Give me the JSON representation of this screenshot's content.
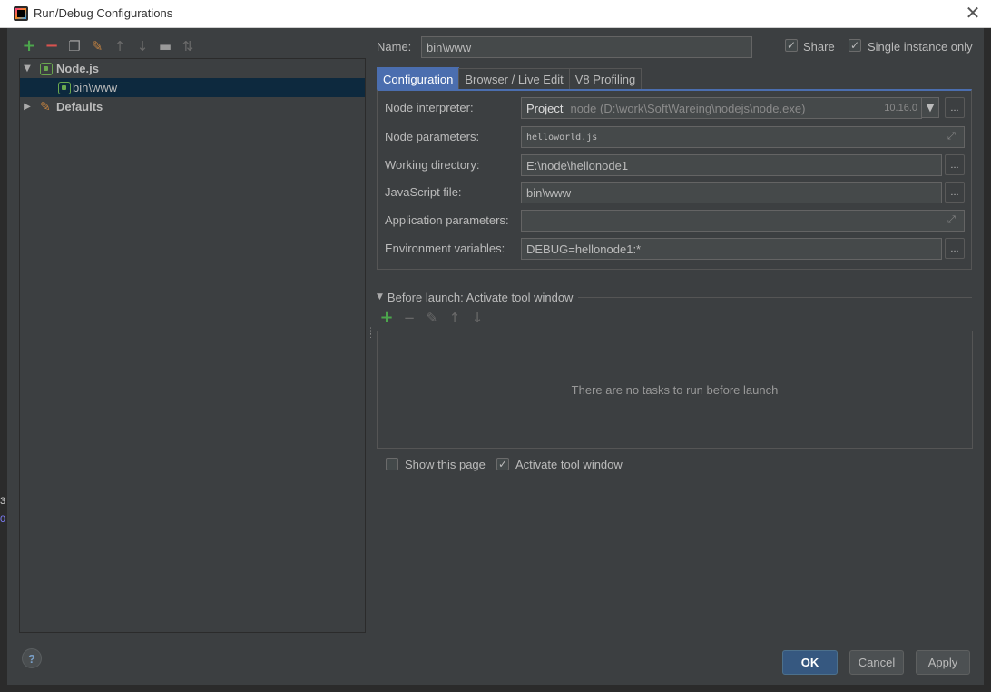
{
  "window": {
    "title": "Run/Debug Configurations",
    "close_glyph": "✕"
  },
  "background": {
    "left_digits": [
      "3",
      "0"
    ]
  },
  "left_toolbar": {
    "icons": [
      "add-icon",
      "remove-icon",
      "copy-icon",
      "edit-defaults-icon",
      "move-up-icon",
      "move-down-icon",
      "folder-icon",
      "sort-icon"
    ]
  },
  "tree": {
    "items": [
      {
        "label": "Node.js",
        "icon": "nodejs-icon",
        "expanded": true
      },
      {
        "label": "bin\\www",
        "icon": "nodejs-config-icon",
        "selected": true
      },
      {
        "label": "Defaults",
        "icon": "wrench-icon",
        "expanded": false
      }
    ]
  },
  "name_row": {
    "label": "Name:",
    "value": "bin\\www"
  },
  "share": {
    "label": "Share",
    "checked": true
  },
  "single_instance": {
    "label": "Single instance only",
    "checked": true
  },
  "tabs": [
    {
      "label": "Configuration",
      "active": true
    },
    {
      "label": "Browser / Live Edit",
      "active": false
    },
    {
      "label": "V8 Profiling",
      "active": false
    }
  ],
  "fields": {
    "node_interpreter": {
      "label": "Node interpreter:",
      "prefix": "Project",
      "path": "node (D:\\work\\SoftWareing\\nodejs\\node.exe)",
      "version": "10.16.0"
    },
    "node_parameters": {
      "label": "Node parameters:",
      "value": "helloworld.js"
    },
    "working_directory": {
      "label": "Working directory:",
      "value": "E:\\node\\hellonode1"
    },
    "javascript_file": {
      "label": "JavaScript file:",
      "value": "bin\\www"
    },
    "application_parameters": {
      "label": "Application parameters:",
      "value": ""
    },
    "environment_variables": {
      "label": "Environment variables:",
      "value": "DEBUG=hellonode1:*"
    }
  },
  "ellipsis_label": "...",
  "before_launch": {
    "header": "Before launch: Activate tool window",
    "empty_text": "There are no tasks to run before launch"
  },
  "show_this_page": {
    "label": "Show this page",
    "checked": false
  },
  "activate_tool_window": {
    "label": "Activate tool window",
    "checked": true
  },
  "buttons": {
    "ok": "OK",
    "cancel": "Cancel",
    "apply": "Apply",
    "help": "?"
  }
}
